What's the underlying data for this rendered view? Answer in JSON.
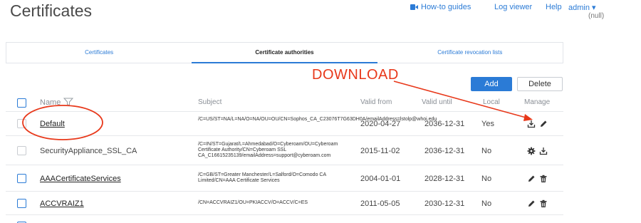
{
  "page": {
    "title": "Certificates"
  },
  "topnav": {
    "guides": "How-to guides",
    "log_viewer": "Log viewer",
    "help": "Help",
    "admin": "admin ▾",
    "admin_sub": "(null)"
  },
  "tabs": [
    {
      "label": "Certificates",
      "active": false
    },
    {
      "label": "Certificate authorities",
      "active": true
    },
    {
      "label": "Certificate revocation lists",
      "active": false
    }
  ],
  "annotation": {
    "text": "DOWNLOAD"
  },
  "toolbar": {
    "add": "Add",
    "delete": "Delete"
  },
  "table": {
    "headers": {
      "name": "Name",
      "subject": "Subject",
      "valid_from": "Valid from",
      "valid_until": "Valid until",
      "local": "Local",
      "manage": "Manage"
    },
    "rows": [
      {
        "name": "Default",
        "subject": "/C=US/ST=NA/L=NA/O=NA/OU=OU/CN=Sophos_CA_C23076T7G63DH0A/emailAddress=lstolp@whoi.edu",
        "valid_from": "2020-04-27",
        "valid_until": "2036-12-31",
        "local": "Yes"
      },
      {
        "name": "SecurityAppliance_SSL_CA",
        "subject": "/C=IN/ST=Gujarat/L=Ahmedabad/O=Cyberoam/OU=Cyberoam Certificate Authority/CN=Cyberoam SSL CA_C16615235139/emailAddress=support@cyberoam.com",
        "valid_from": "2015-11-02",
        "valid_until": "2036-12-31",
        "local": "No"
      },
      {
        "name": "AAACertificateServices",
        "subject": "/C=GB/ST=Greater Manchester/L=Salford/O=Comodo CA Limited/CN=AAA Certificate Services",
        "valid_from": "2004-01-01",
        "valid_until": "2028-12-31",
        "local": "No"
      },
      {
        "name": "ACCVRAIZ1",
        "subject": "/CN=ACCVRAIZ1/OU=PKIACCV/O=ACCV/C=ES",
        "valid_from": "2011-05-05",
        "valid_until": "2030-12-31",
        "local": "No"
      }
    ]
  },
  "colors": {
    "accent": "#2b7bd6",
    "annotation": "#e8381a"
  }
}
